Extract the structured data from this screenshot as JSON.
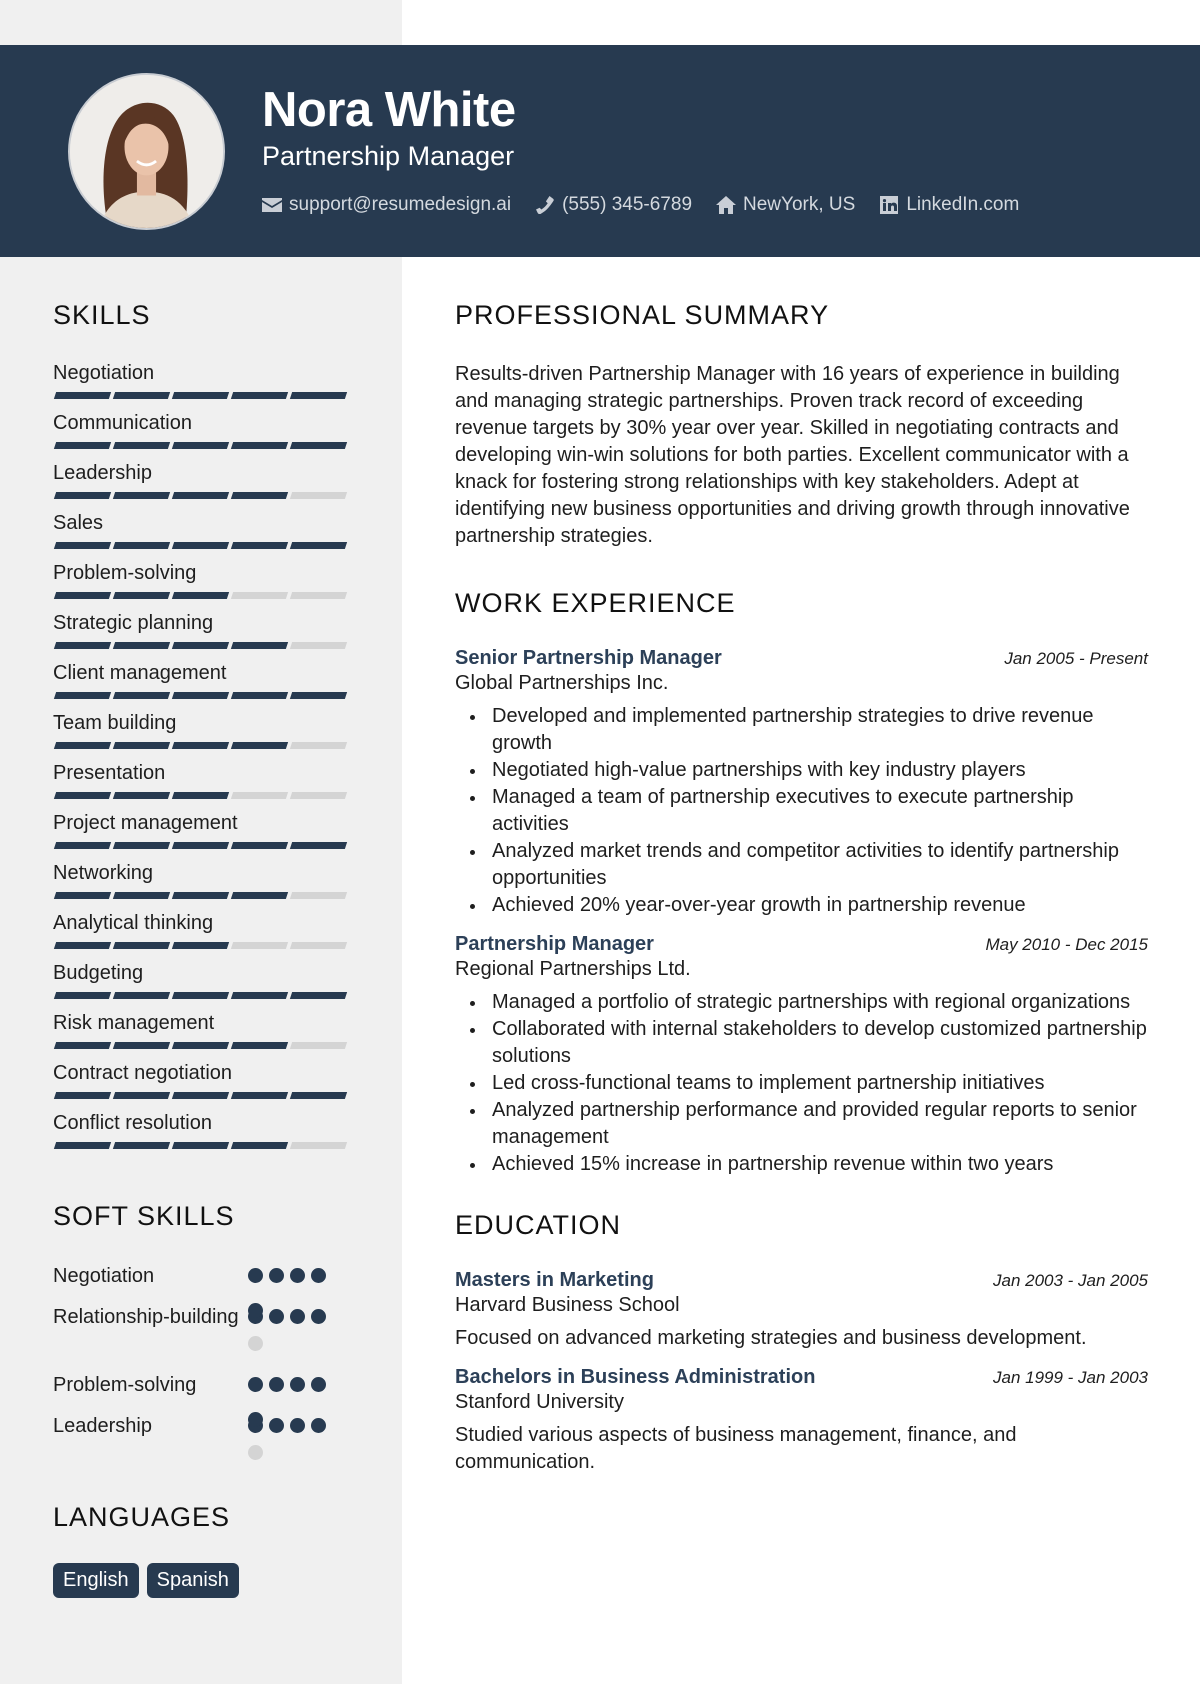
{
  "header": {
    "name": "Nora White",
    "title": "Partnership Manager",
    "contacts": [
      {
        "icon": "envelope-icon",
        "text": "support@resumedesign.ai"
      },
      {
        "icon": "phone-icon",
        "text": "(555) 345-6789"
      },
      {
        "icon": "home-icon",
        "text": "NewYork, US"
      },
      {
        "icon": "linkedin-icon",
        "text": "LinkedIn.com"
      }
    ]
  },
  "colors": {
    "accent": "#273a50",
    "sidebar": "#f0f0f0",
    "inactive": "#d4d4d4"
  },
  "skills": {
    "title": "SKILLS",
    "max": 5,
    "items": [
      {
        "name": "Negotiation",
        "level": 5
      },
      {
        "name": "Communication",
        "level": 5
      },
      {
        "name": "Leadership",
        "level": 4
      },
      {
        "name": "Sales",
        "level": 5
      },
      {
        "name": "Problem-solving",
        "level": 3
      },
      {
        "name": "Strategic planning",
        "level": 4
      },
      {
        "name": "Client management",
        "level": 5
      },
      {
        "name": "Team building",
        "level": 4
      },
      {
        "name": "Presentation",
        "level": 3
      },
      {
        "name": "Project management",
        "level": 5
      },
      {
        "name": "Networking",
        "level": 4
      },
      {
        "name": "Analytical thinking",
        "level": 3
      },
      {
        "name": "Budgeting",
        "level": 5
      },
      {
        "name": "Risk management",
        "level": 4
      },
      {
        "name": "Contract negotiation",
        "level": 5
      },
      {
        "name": "Conflict resolution",
        "level": 4
      }
    ]
  },
  "soft_skills": {
    "title": "SOFT SKILLS",
    "items": [
      {
        "name": "Negotiation",
        "level": 4,
        "max": 4
      },
      {
        "name": "Relationship-building",
        "level": 4,
        "max": 5
      },
      {
        "name": "Problem-solving",
        "level": 4,
        "max": 4
      },
      {
        "name": "Leadership",
        "level": 4,
        "max": 5
      }
    ]
  },
  "languages": {
    "title": "LANGUAGES",
    "items": [
      "English",
      "Spanish"
    ]
  },
  "summary": {
    "title": "PROFESSIONAL SUMMARY",
    "text": "Results-driven Partnership Manager with 16 years of experience in building and managing strategic partnerships. Proven track record of exceeding revenue targets by 30% year over year. Skilled in negotiating contracts and developing win-win solutions for both parties. Excellent communicator with a knack for fostering strong relationships with key stakeholders. Adept at identifying new business opportunities and driving growth through innovative partnership strategies."
  },
  "work": {
    "title": "WORK EXPERIENCE",
    "jobs": [
      {
        "title": "Senior Partnership Manager",
        "company": "Global Partnerships Inc.",
        "date": "Jan 2005 - Present",
        "bullets": [
          "Developed and implemented partnership strategies to drive revenue growth",
          "Negotiated high-value partnerships with key industry players",
          "Managed a team of partnership executives to execute partnership activities",
          "Analyzed market trends and competitor activities to identify partnership opportunities",
          "Achieved 20% year-over-year growth in partnership revenue"
        ]
      },
      {
        "title": "Partnership Manager",
        "company": "Regional Partnerships Ltd.",
        "date": "May 2010 - Dec 2015",
        "bullets": [
          "Managed a portfolio of strategic partnerships with regional organizations",
          "Collaborated with internal stakeholders to develop customized partnership solutions",
          "Led cross-functional teams to implement partnership initiatives",
          "Analyzed partnership performance and provided regular reports to senior management",
          "Achieved 15% increase in partnership revenue within two years"
        ]
      }
    ]
  },
  "education": {
    "title": "EDUCATION",
    "items": [
      {
        "degree": "Masters in Marketing",
        "school": "Harvard Business School",
        "date": "Jan 2003 - Jan 2005",
        "description": "Focused on advanced marketing strategies and business development."
      },
      {
        "degree": "Bachelors in Business Administration",
        "school": "Stanford University",
        "date": "Jan 1999 - Jan 2003",
        "description": "Studied various aspects of business management, finance, and communication."
      }
    ]
  }
}
